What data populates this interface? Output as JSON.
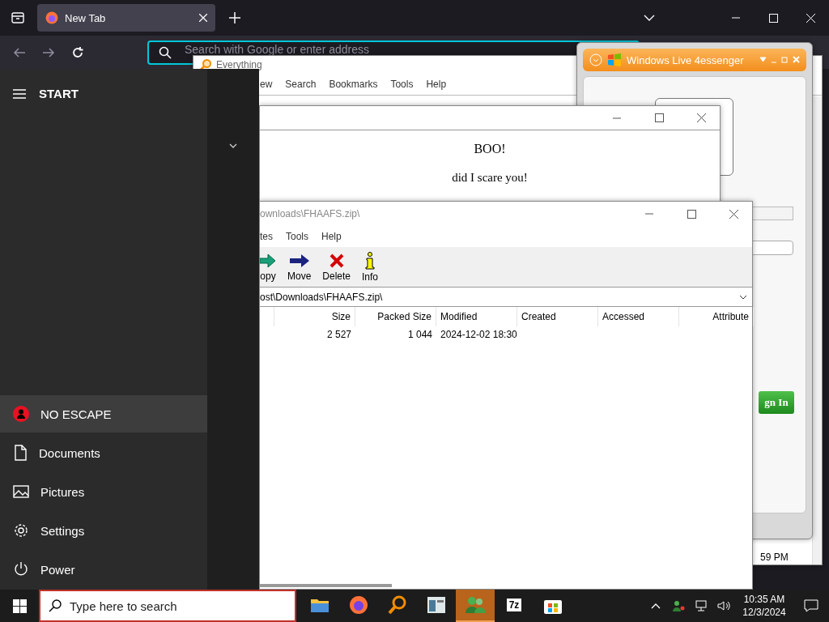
{
  "browser": {
    "tabs": [
      {
        "label": "New Tab",
        "selected": true
      }
    ],
    "nav": [
      {
        "kind": "back",
        "disabled": true
      },
      {
        "kind": "forward",
        "disabled": true
      },
      {
        "kind": "reload",
        "disabled": false
      }
    ],
    "address_bar": {
      "placeholder": "Search with Google or enter address"
    }
  },
  "start_menu": {
    "title": "START",
    "items": [
      {
        "label": "NO ESCAPE",
        "kind": "user",
        "selected": true
      },
      {
        "label": "Documents",
        "kind": "documents",
        "selected": false
      },
      {
        "label": "Pictures",
        "kind": "pictures",
        "selected": false
      },
      {
        "label": "Settings",
        "kind": "settings",
        "selected": false
      },
      {
        "label": "Power",
        "kind": "power",
        "selected": false
      }
    ]
  },
  "everything_window": {
    "title": "Everything",
    "menu": [
      "ew",
      "Search",
      "Bookmarks",
      "Tools",
      "Help"
    ],
    "visible_cell": "59 PM"
  },
  "message_window": {
    "heading": "BOO!",
    "text": "did I scare you!"
  },
  "messenger_window": {
    "title": "Windows Live 4essenger",
    "sign_in_button": "gn In"
  },
  "zip_window": {
    "title": "ownloads\\FHAAFS.zip\\",
    "menu": [
      "tes",
      "Tools",
      "Help"
    ],
    "toolbar": [
      {
        "label": "opy",
        "kind": "copy"
      },
      {
        "label": "Move",
        "kind": "move"
      },
      {
        "label": "Delete",
        "kind": "delete"
      },
      {
        "label": "Info",
        "kind": "info"
      }
    ],
    "path": "ost\\Downloads\\FHAAFS.zip\\",
    "columns": [
      "Size",
      "Packed Size",
      "Modified",
      "Created",
      "Accessed",
      "Attribute"
    ],
    "rows": [
      {
        "size": "2 527",
        "packed_size": "1 044",
        "modified": "2024-12-02 18:30"
      }
    ]
  },
  "taskbar": {
    "search_placeholder": "Type here to search",
    "apps": [
      {
        "kind": "folder",
        "selected": false
      },
      {
        "kind": "browser",
        "selected": false
      },
      {
        "kind": "magnifier",
        "selected": false
      },
      {
        "kind": "window",
        "selected": false
      },
      {
        "kind": "messenger",
        "selected": true
      },
      {
        "kind": "zip",
        "label": "7z",
        "selected": false
      },
      {
        "kind": "store",
        "selected": false
      }
    ],
    "time": "10:35 AM",
    "date": "12/3/2024"
  }
}
